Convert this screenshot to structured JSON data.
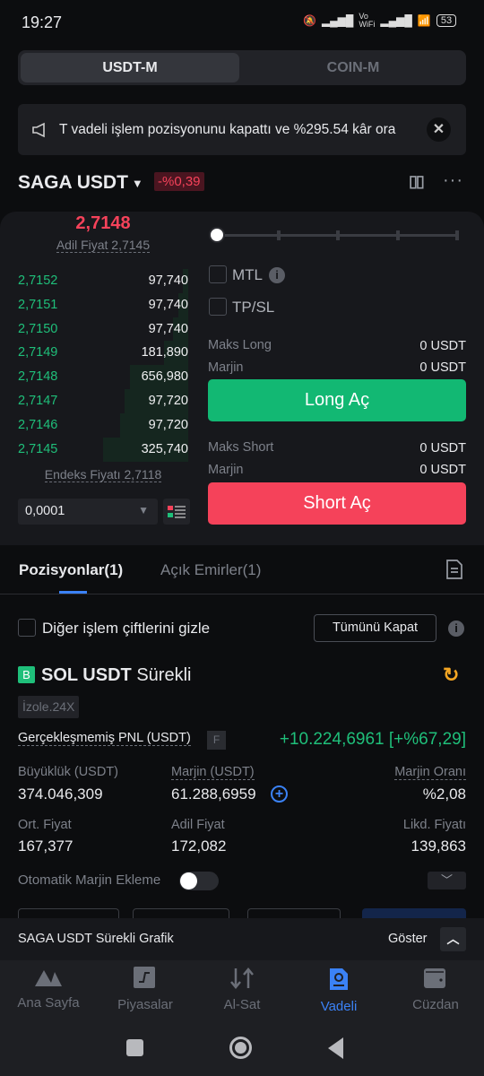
{
  "status": {
    "time": "19:27",
    "battery": "53",
    "wifi_label": "Vo\nWiFi"
  },
  "segment": {
    "tabs": [
      "USDT-M",
      "COIN-M"
    ],
    "active": 0
  },
  "notice": {
    "text": "T vadeli işlem pozisyonunu kapattı ve %295.54 kâr ora"
  },
  "pair": {
    "name": "SAGA USDT",
    "change": "-%0,39"
  },
  "orderbook": {
    "last_price": "2,7148",
    "fair_price": "Adil Fiyat 2,7145",
    "index_price": "Endeks Fiyatı 2,7118",
    "precision": "0,0001",
    "rows": [
      {
        "price": "2,7152",
        "qty": "97,740"
      },
      {
        "price": "2,7151",
        "qty": "97,740"
      },
      {
        "price": "2,7150",
        "qty": "97,740"
      },
      {
        "price": "2,7149",
        "qty": "181,890"
      },
      {
        "price": "2,7148",
        "qty": "656,980"
      },
      {
        "price": "2,7147",
        "qty": "97,720"
      },
      {
        "price": "2,7146",
        "qty": "97,720"
      },
      {
        "price": "2,7145",
        "qty": "325,740"
      }
    ]
  },
  "order": {
    "slider_percent": 0,
    "mtl": "MTL",
    "tpsl": "TP/SL",
    "max_long_label": "Maks Long",
    "max_long": "0 USDT",
    "margin_label": "Marjin",
    "margin_long": "0 USDT",
    "long_btn": "Long Aç",
    "max_short_label": "Maks Short",
    "max_short": "0 USDT",
    "margin_short": "0 USDT",
    "short_btn": "Short Aç"
  },
  "positions": {
    "tabs": [
      "Pozisyonlar(1)",
      "Açık Emirler(1)"
    ],
    "hide_label": "Diğer işlem çiftlerini gizle",
    "close_all": "Tümünü Kapat",
    "item": {
      "side": "B",
      "symbol": "SOL USDT",
      "type": "Sürekli",
      "mode": "İzole.24X",
      "pnl_label": "Gerçekleşmemiş PNL (USDT)",
      "pnl_flag": "F",
      "pnl": "+10.224,6961 [+%67,29]",
      "size_label": "Büyüklük (USDT)",
      "size": "374.046,309",
      "margin_label": "Marjin (USDT)",
      "margin": "61.288,6959",
      "ratio_label": "Marjin Oranı",
      "ratio": "%2,08",
      "avg_label": "Ort. Fiyat",
      "avg": "167,377",
      "fair_label": "Adil Fiyat",
      "fair": "172,082",
      "liq_label": "Likd. Fiyatı",
      "liq": "139,863",
      "auto_margin": "Otomatik Marjin Ekleme",
      "auto_margin_on": false
    }
  },
  "chart_bar": {
    "title": "SAGA USDT Sürekli Grafik",
    "show": "Göster"
  },
  "nav": {
    "items": [
      "Ana Sayfa",
      "Piyasalar",
      "Al-Sat",
      "Vadeli",
      "Cüzdan"
    ],
    "active": 3
  },
  "colors": {
    "green": "#1fbf7a",
    "red": "#f5425a",
    "blue": "#3b82f6",
    "accent_orange": "#f5a623"
  }
}
